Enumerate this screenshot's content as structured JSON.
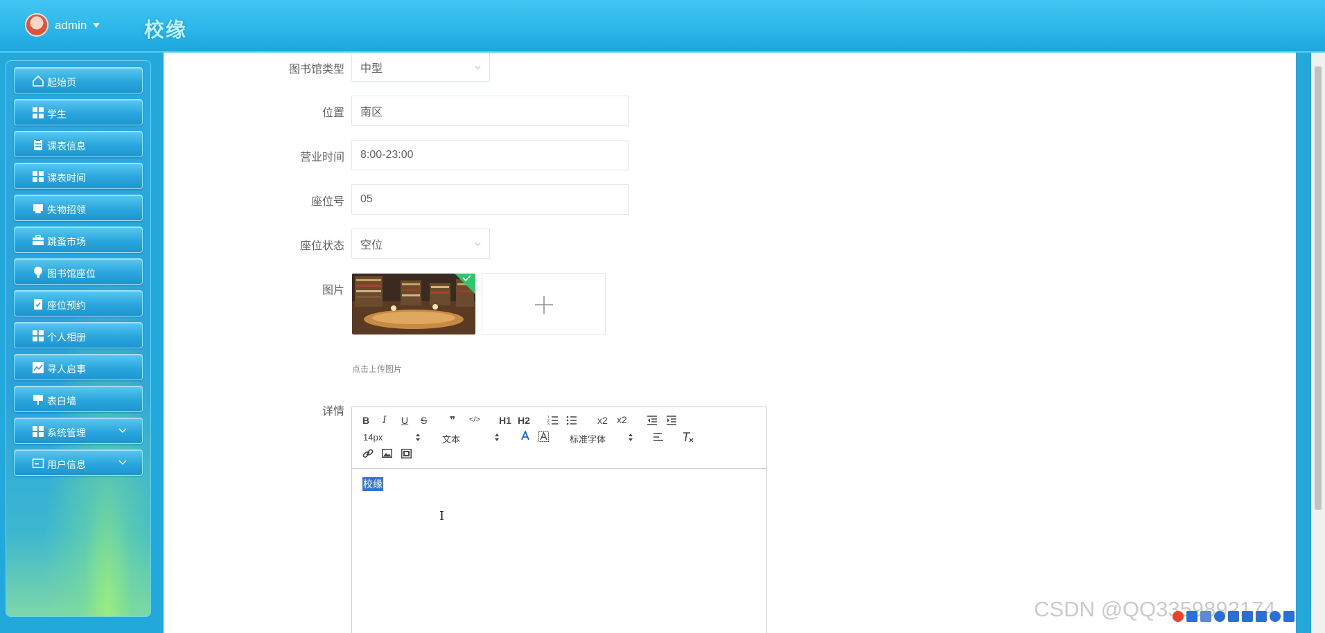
{
  "header": {
    "user": "admin",
    "brand": "校缘"
  },
  "sidebar": {
    "items": [
      {
        "label": "起始页",
        "icon": "home-icon"
      },
      {
        "label": "学生",
        "icon": "grid-icon"
      },
      {
        "label": "课表信息",
        "icon": "clipboard-icon"
      },
      {
        "label": "课表时间",
        "icon": "grid-icon"
      },
      {
        "label": "失物招领",
        "icon": "inbox-icon"
      },
      {
        "label": "跳蚤市场",
        "icon": "briefcase-icon"
      },
      {
        "label": "图书馆座位",
        "icon": "bulb-icon"
      },
      {
        "label": "座位预约",
        "icon": "clipboard-check-icon"
      },
      {
        "label": "个人相册",
        "icon": "grid-icon"
      },
      {
        "label": "寻人启事",
        "icon": "chart-icon"
      },
      {
        "label": "表白墙",
        "icon": "board-icon"
      },
      {
        "label": "系统管理",
        "icon": "grid-icon"
      },
      {
        "label": "用户信息",
        "icon": "wallet-icon"
      }
    ]
  },
  "form": {
    "library_type": {
      "label": "图书馆类型",
      "value": "中型"
    },
    "location": {
      "label": "位置",
      "value": "南区"
    },
    "hours": {
      "label": "营业时间",
      "value": "8:00-23:00"
    },
    "seat_no": {
      "label": "座位号",
      "value": "05"
    },
    "seat_status": {
      "label": "座位状态",
      "value": "空位"
    },
    "image": {
      "label": "图片",
      "hint": "点击上传图片"
    },
    "details": {
      "label": "详情",
      "content": "校缘"
    }
  },
  "editor": {
    "font_size": "14px",
    "text_type": "文本",
    "font_family": "标准字体",
    "buttons": [
      "B",
      "I",
      "U",
      "S",
      "❞",
      "</>",
      "H1",
      "H2",
      "x2",
      "x2"
    ]
  },
  "watermark": "CSDN @QQ3359892174",
  "colors": {
    "brand_blue": "#23a8dc",
    "highlight": "#3574d6"
  }
}
